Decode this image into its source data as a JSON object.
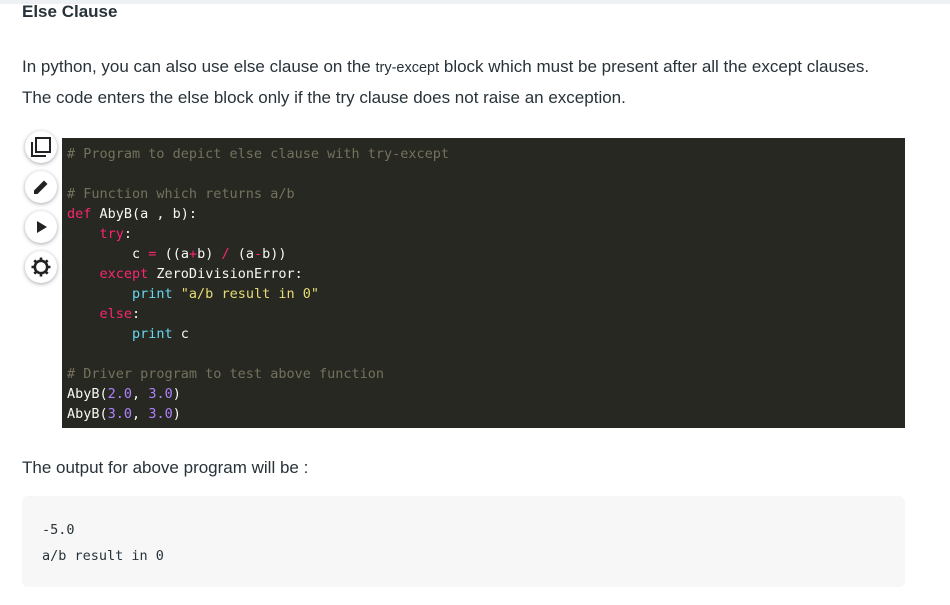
{
  "section": {
    "title": "Else Clause",
    "para_before": "In python, you can also use else clause on the ",
    "para_code": "try-except",
    "para_after": " block which must be present after all the except clauses. The code enters the else block only if the try clause does not raise an exception."
  },
  "toolbar": [
    {
      "icon": "copy-icon"
    },
    {
      "icon": "edit-icon"
    },
    {
      "icon": "run-icon"
    },
    {
      "icon": "settings-icon"
    }
  ],
  "code": {
    "comment1": "# Program to depict else clause with try-except",
    "comment2": "# Function which returns a/b",
    "def_kw": "def",
    "def_sig": " AbyB(a , b):",
    "try_kw": "try",
    "colon": ":",
    "c_assign_a": "c ",
    "eq": "=",
    "c_assign_b": " ((a",
    "plus": "+",
    "c_assign_c": "b) ",
    "slash": "/",
    "c_assign_d": " (a",
    "minus": "-",
    "c_assign_e": "b))",
    "except_kw": "except",
    "except_rest": " ZeroDivisionError:",
    "print_kw": "print",
    "print_str": " \"a/b result in 0\"",
    "else_kw": "else",
    "print_c": " c",
    "comment3": "# Driver program to test above function",
    "call_fn": "AbyB",
    "call1_open": "(",
    "call1_a": "2.0",
    "comma": ", ",
    "call1_b": "3.0",
    "call_close": ")",
    "call2_a": "3.0",
    "call2_b": "3.0"
  },
  "output": {
    "label": "The output for above program will be :",
    "line1": "-5.0",
    "line2": "a/b result in 0"
  },
  "colors": {
    "code_bg": "#272822",
    "keyword": "#f92672",
    "comment": "#75715e",
    "number": "#ae81ff",
    "string": "#e6db74",
    "builtin": "#66d9ef"
  }
}
